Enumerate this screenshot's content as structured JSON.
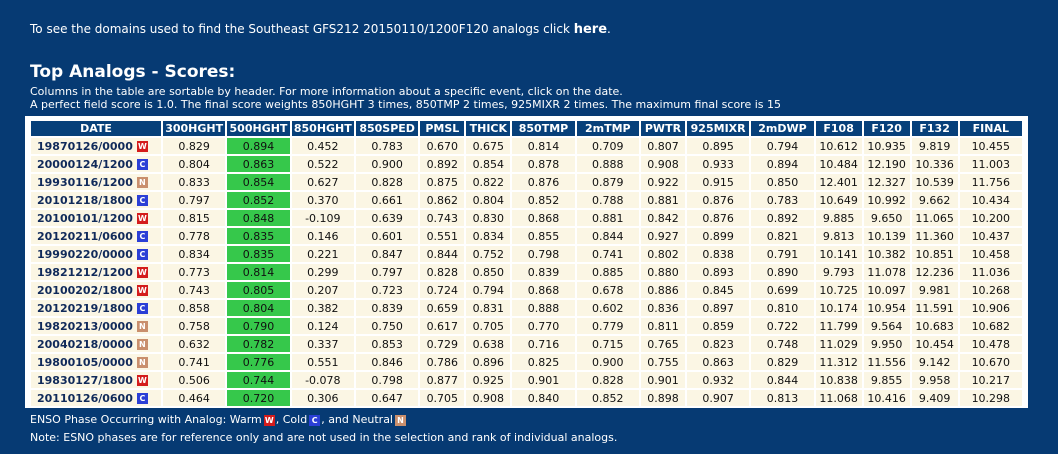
{
  "intro": {
    "text": "To see the domains used to find the Southeast GFS212 20150110/1200F120 analogs click",
    "link": "here",
    "suffix": "."
  },
  "title": "Top Analogs - Scores:",
  "desc": {
    "line1": "Columns in the table are sortable by header. For more information about a specific event, click on the date.",
    "line2": "A perfect field score is 1.0. The final score weights 850HGHT 3 times, 850TMP 2 times, 925MIXR 2 times. The maximum final score is 15"
  },
  "colors": {
    "background": "#063a73",
    "header": "#07407a",
    "cell": "#fbf6e4",
    "highlight": "#36c84b",
    "warm": "#d41c1c",
    "cold": "#2b3fd6",
    "neutral": "#c98f6d"
  },
  "table": {
    "headers": [
      "DATE",
      "300HGHT",
      "500HGHT",
      "850HGHT",
      "850SPED",
      "PMSL",
      "THICK",
      "850TMP",
      "2mTMP",
      "PWTR",
      "925MIXR",
      "2mDWP",
      "F108",
      "F120",
      "F132",
      "FINAL"
    ],
    "highlight_col": 1,
    "rows": [
      {
        "date": "19870126/0000",
        "enso": "W",
        "values": [
          "0.829",
          "0.894",
          "0.452",
          "0.783",
          "0.670",
          "0.675",
          "0.814",
          "0.709",
          "0.807",
          "0.895",
          "0.794",
          "10.612",
          "10.935",
          "9.819",
          "10.455"
        ]
      },
      {
        "date": "20000124/1200",
        "enso": "C",
        "values": [
          "0.804",
          "0.863",
          "0.522",
          "0.900",
          "0.892",
          "0.854",
          "0.878",
          "0.888",
          "0.908",
          "0.933",
          "0.894",
          "10.484",
          "12.190",
          "10.336",
          "11.003"
        ]
      },
      {
        "date": "19930116/1200",
        "enso": "N",
        "values": [
          "0.833",
          "0.854",
          "0.627",
          "0.828",
          "0.875",
          "0.822",
          "0.876",
          "0.879",
          "0.922",
          "0.915",
          "0.850",
          "12.401",
          "12.327",
          "10.539",
          "11.756"
        ]
      },
      {
        "date": "20101218/1800",
        "enso": "C",
        "values": [
          "0.797",
          "0.852",
          "0.370",
          "0.661",
          "0.862",
          "0.804",
          "0.852",
          "0.788",
          "0.881",
          "0.876",
          "0.783",
          "10.649",
          "10.992",
          "9.662",
          "10.434"
        ]
      },
      {
        "date": "20100101/1200",
        "enso": "W",
        "values": [
          "0.815",
          "0.848",
          "-0.109",
          "0.639",
          "0.743",
          "0.830",
          "0.868",
          "0.881",
          "0.842",
          "0.876",
          "0.892",
          "9.885",
          "9.650",
          "11.065",
          "10.200"
        ]
      },
      {
        "date": "20120211/0600",
        "enso": "C",
        "values": [
          "0.778",
          "0.835",
          "0.146",
          "0.601",
          "0.551",
          "0.834",
          "0.855",
          "0.844",
          "0.927",
          "0.899",
          "0.821",
          "9.813",
          "10.139",
          "11.360",
          "10.437"
        ]
      },
      {
        "date": "19990220/0000",
        "enso": "C",
        "values": [
          "0.834",
          "0.835",
          "0.221",
          "0.847",
          "0.844",
          "0.752",
          "0.798",
          "0.741",
          "0.802",
          "0.838",
          "0.791",
          "10.141",
          "10.382",
          "10.851",
          "10.458"
        ]
      },
      {
        "date": "19821212/1200",
        "enso": "W",
        "values": [
          "0.773",
          "0.814",
          "0.299",
          "0.797",
          "0.828",
          "0.850",
          "0.839",
          "0.885",
          "0.880",
          "0.893",
          "0.890",
          "9.793",
          "11.078",
          "12.236",
          "11.036"
        ]
      },
      {
        "date": "20100202/1800",
        "enso": "W",
        "values": [
          "0.743",
          "0.805",
          "0.207",
          "0.723",
          "0.724",
          "0.794",
          "0.868",
          "0.678",
          "0.886",
          "0.845",
          "0.699",
          "10.725",
          "10.097",
          "9.981",
          "10.268"
        ]
      },
      {
        "date": "20120219/1800",
        "enso": "C",
        "values": [
          "0.858",
          "0.804",
          "0.382",
          "0.839",
          "0.659",
          "0.831",
          "0.888",
          "0.602",
          "0.836",
          "0.897",
          "0.810",
          "10.174",
          "10.954",
          "11.591",
          "10.906"
        ]
      },
      {
        "date": "19820213/0000",
        "enso": "N",
        "values": [
          "0.758",
          "0.790",
          "0.124",
          "0.750",
          "0.617",
          "0.705",
          "0.770",
          "0.779",
          "0.811",
          "0.859",
          "0.722",
          "11.799",
          "9.564",
          "10.683",
          "10.682"
        ]
      },
      {
        "date": "20040218/0000",
        "enso": "N",
        "values": [
          "0.632",
          "0.782",
          "0.337",
          "0.853",
          "0.729",
          "0.638",
          "0.716",
          "0.715",
          "0.765",
          "0.823",
          "0.748",
          "11.029",
          "9.950",
          "10.454",
          "10.478"
        ]
      },
      {
        "date": "19800105/0000",
        "enso": "N",
        "values": [
          "0.741",
          "0.776",
          "0.551",
          "0.846",
          "0.786",
          "0.896",
          "0.825",
          "0.900",
          "0.755",
          "0.863",
          "0.829",
          "11.312",
          "11.556",
          "9.142",
          "10.670"
        ]
      },
      {
        "date": "19830127/1800",
        "enso": "W",
        "values": [
          "0.506",
          "0.744",
          "-0.078",
          "0.798",
          "0.877",
          "0.925",
          "0.901",
          "0.828",
          "0.901",
          "0.932",
          "0.844",
          "10.838",
          "9.855",
          "9.958",
          "10.217"
        ]
      },
      {
        "date": "20110126/0600",
        "enso": "C",
        "values": [
          "0.464",
          "0.720",
          "0.306",
          "0.647",
          "0.705",
          "0.908",
          "0.840",
          "0.852",
          "0.898",
          "0.907",
          "0.813",
          "11.068",
          "10.416",
          "9.409",
          "10.298"
        ]
      }
    ]
  },
  "legend": {
    "text": "ENSO Phase Occurring with Analog: Warm",
    "warm_badge": "W",
    "cold_text": ", Cold",
    "cold_badge": "C",
    "neutral_text": ", and Neutral",
    "neutral_badge": "N"
  },
  "note": "Note: ESNO phases are for reference only and are not used in the selection and rank of individual analogs."
}
